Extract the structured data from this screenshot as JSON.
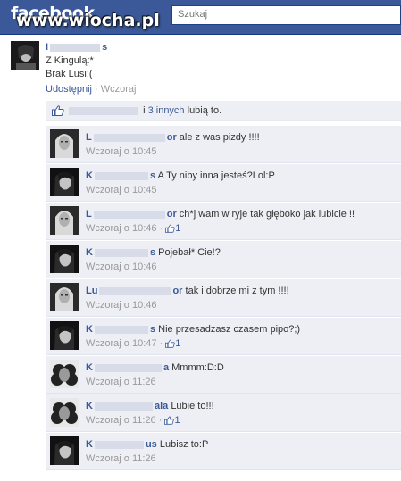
{
  "header": {
    "logo": "facebook",
    "watermark": "www.wiocha.pl",
    "search_placeholder": "Szukaj"
  },
  "post": {
    "author_first": "I",
    "author_last": "s",
    "lines": [
      "Z Kingulą:*",
      "Brak Lusi:("
    ],
    "share_label": "Udostępnij",
    "separator": " · ",
    "time": "Wczoraj"
  },
  "likes": {
    "prefix": "i",
    "others_link": "3 innych",
    "suffix": "lubią to."
  },
  "comments": [
    {
      "name_start": "L",
      "name_end": "or",
      "text": "ale z was pizdy !!!!",
      "time": "Wczoraj o 10:45",
      "likes": ""
    },
    {
      "name_start": "K",
      "name_end": "s",
      "text": "A Ty niby inna jesteś?Lol:P",
      "time": "Wczoraj o 10:45",
      "likes": ""
    },
    {
      "name_start": "L",
      "name_end": "or",
      "text": "ch*j wam w ryje tak głęboko jak lubicie !!",
      "time": "Wczoraj o 10:46",
      "likes": "1"
    },
    {
      "name_start": "K",
      "name_end": "s",
      "text": "Pojebał* Cie!?",
      "time": "Wczoraj o 10:46",
      "likes": ""
    },
    {
      "name_start": "Lu",
      "name_end": "or",
      "text": "tak i dobrze mi z tym !!!!",
      "time": "Wczoraj o 10:46",
      "likes": ""
    },
    {
      "name_start": "K",
      "name_end": "s",
      "text": "Nie przesadzasz czasem pipo?;)",
      "time": "Wczoraj o 10:47",
      "likes": "1"
    },
    {
      "name_start": "K",
      "name_end": "a",
      "text": "Mmmm:D:D",
      "time": "Wczoraj o 11:26",
      "likes": ""
    },
    {
      "name_start": "K",
      "name_end": "ala",
      "text": "Lubie to!!!",
      "time": "Wczoraj o 11:26",
      "likes": "1"
    },
    {
      "name_start": "K",
      "name_end": "us",
      "text": "Lubisz to:P",
      "time": "Wczoraj o 11:26",
      "likes": ""
    }
  ],
  "colors": {
    "brand": "#3b5998",
    "comment_bg": "#edeff4",
    "meta_grey": "#999999"
  }
}
